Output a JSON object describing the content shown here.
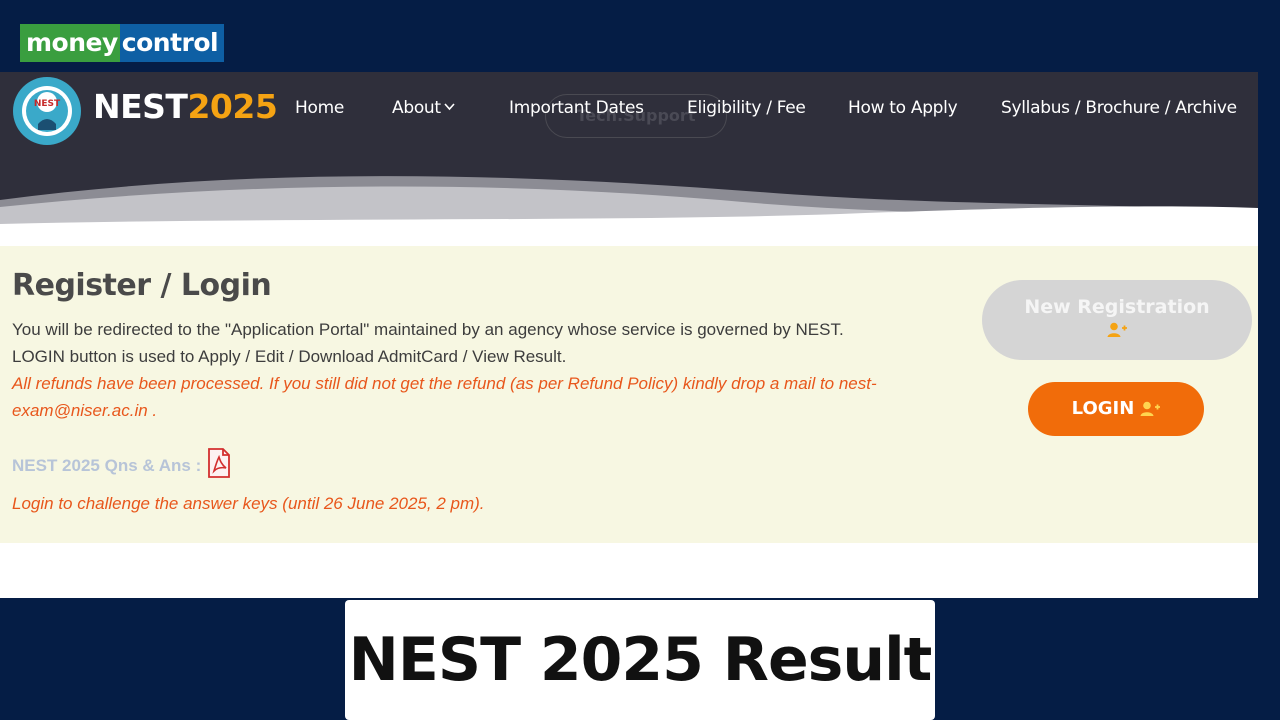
{
  "publisher": {
    "money": "money",
    "control": "control"
  },
  "site": {
    "emblem_text": "NEST",
    "brand_name": "NEST",
    "brand_year": "2025",
    "nav": {
      "home": "Home",
      "about": "About",
      "important_dates": "Important Dates",
      "eligibility": "Eligibility / Fee",
      "how_to_apply": "How to Apply",
      "syllabus": "Syllabus / Brochure / Archive"
    },
    "tech_support": "Tech.Support",
    "heading": "Register / Login",
    "para1": "You will be redirected to the \"Application Portal\" maintained by an agency whose service is governed by NEST.",
    "para2": "LOGIN button is used to Apply / Edit / Download AdmitCard / View Result.",
    "refund_notice": "All refunds have been processed. If you still did not get the refund (as per Refund Policy) kindly drop a mail to nest-exam@niser.ac.in .",
    "qns_label": "NEST 2025 Qns & Ans :",
    "challenge_notice": "Login to challenge the answer keys (until 26 June 2025, 2 pm).",
    "new_registration": "New Registration",
    "login": "LOGIN"
  },
  "caption": "NEST 2025 Result",
  "icons": {
    "emblem": "nest-emblem-icon",
    "chevron": "chevron-down-icon",
    "pdf": "pdf-icon",
    "user_add": "user-add-icon"
  },
  "colors": {
    "background": "#051d45",
    "header": "#2f2f3b",
    "brand_year": "#f5a313",
    "content_bg": "#f7f7e2",
    "notice": "#e8571c",
    "login_button": "#f16c0a",
    "registration_button": "#d5d5d5"
  }
}
